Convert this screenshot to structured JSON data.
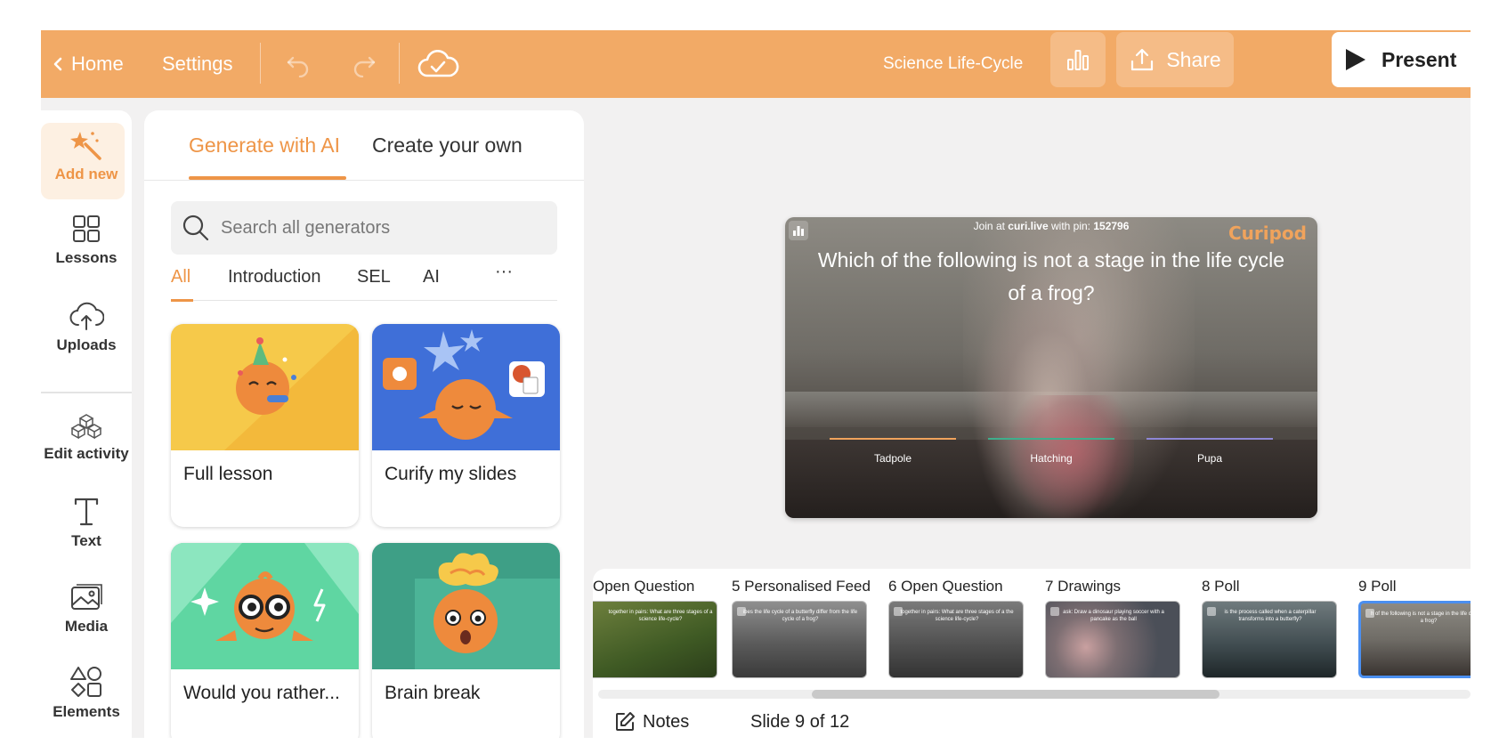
{
  "topbar": {
    "home_label": "Home",
    "settings_label": "Settings",
    "lesson_title": "Science Life-Cycle",
    "share_label": "Share",
    "present_label": "Present"
  },
  "rail": {
    "items": [
      {
        "label": "Add new",
        "icon": "magic-wand-icon"
      },
      {
        "label": "Lessons",
        "icon": "grid-icon"
      },
      {
        "label": "Uploads",
        "icon": "cloud-upload-icon"
      },
      {
        "label": "Edit activity",
        "icon": "blocks-icon"
      },
      {
        "label": "Text",
        "icon": "text-icon"
      },
      {
        "label": "Media",
        "icon": "image-icon"
      },
      {
        "label": "Elements",
        "icon": "shapes-icon"
      }
    ]
  },
  "panel": {
    "tabs": [
      "Generate with AI",
      "Create your own"
    ],
    "search_placeholder": "Search all generators",
    "filters": [
      "All",
      "Introduction",
      "SEL",
      "AI",
      "···"
    ],
    "cards": [
      {
        "title": "Full lesson",
        "color": "#f6c94a"
      },
      {
        "title": "Curify my slides",
        "color": "#3f6fd8"
      },
      {
        "title": "Would you rather...",
        "color": "#5fd6a2"
      },
      {
        "title": "Brain break",
        "color": "#3e9f86"
      }
    ]
  },
  "slide": {
    "join_prefix": "Join at ",
    "join_site": "curi.live",
    "join_mid": " with pin: ",
    "join_pin": "152796",
    "brand": "Curipod",
    "question": "Which of the following is not a stage in the life cycle of a frog?",
    "options": [
      {
        "label": "Tadpole",
        "color": "#f0a35c"
      },
      {
        "label": "Hatching",
        "color": "#3fae8c"
      },
      {
        "label": "Pupa",
        "color": "#8e87d6"
      }
    ]
  },
  "filmstrip": {
    "thumbs": [
      {
        "label": "Open Question",
        "text": "together in pairs: What are three stages of a science life-cycle?"
      },
      {
        "label": "5 Personalised Feed",
        "text": "ibes the life cycle of a butterfly differ from the life cycle of a frog?"
      },
      {
        "label": "6 Open Question",
        "text": "together in pairs: What are three stages of a the science life-cycle?"
      },
      {
        "label": "7 Drawings",
        "text": "ask: Draw a dinosaur playing soccer with a pancake as the ball"
      },
      {
        "label": "8 Poll",
        "text": "is the process called when a caterpillar transforms into a butterfly?"
      },
      {
        "label": "9 Poll",
        "text": "h of the following is not a stage in the life cycle of a frog?"
      }
    ],
    "notes_label": "Notes",
    "slide_count": "Slide 9 of 12"
  }
}
